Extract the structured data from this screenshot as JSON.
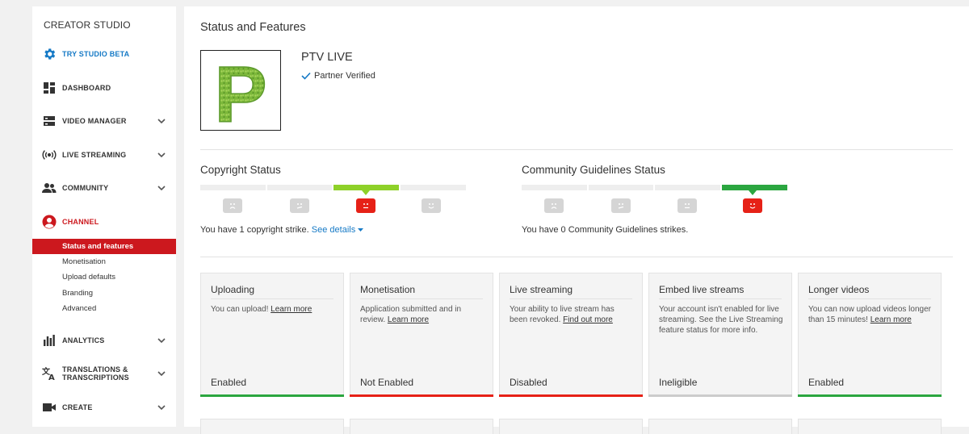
{
  "sidebar": {
    "title": "CREATOR STUDIO",
    "items": [
      {
        "label": "TRY STUDIO BETA",
        "icon": "gear-icon"
      },
      {
        "label": "DASHBOARD",
        "icon": "dashboard-icon"
      },
      {
        "label": "VIDEO MANAGER",
        "icon": "video-manager-icon"
      },
      {
        "label": "LIVE STREAMING",
        "icon": "live-streaming-icon"
      },
      {
        "label": "COMMUNITY",
        "icon": "community-icon"
      },
      {
        "label": "CHANNEL",
        "icon": "channel-icon"
      },
      {
        "label": "ANALYTICS",
        "icon": "analytics-icon"
      },
      {
        "label": "TRANSLATIONS &",
        "label2": "TRANSCRIPTIONS",
        "icon": "translate-icon"
      },
      {
        "label": "CREATE",
        "icon": "camera-icon"
      }
    ],
    "channel_subitems": [
      "Status and features",
      "Monetisation",
      "Upload defaults",
      "Branding",
      "Advanced"
    ],
    "accent_blue": "#167ac6",
    "accent_red": "#cc181e"
  },
  "main": {
    "page_title": "Status and Features",
    "channel_name": "PTV LIVE",
    "partner_status": "Partner Verified",
    "logo_letter": "P",
    "copyright": {
      "title": "Copyright Status",
      "text": "You have 1 copyright strike.",
      "link": "See details",
      "active_level": 3
    },
    "community": {
      "title": "Community Guidelines Status",
      "text": "You have 0 Community Guidelines strikes.",
      "active_level": 4
    },
    "cards": [
      {
        "title": "Uploading",
        "desc": "You can upload!",
        "link": "Learn more",
        "status": "Enabled",
        "color": "#2ba640"
      },
      {
        "title": "Monetisation",
        "desc": "Application submitted and in review.",
        "link": "Learn more",
        "status": "Not Enabled",
        "color": "#e62117"
      },
      {
        "title": "Live streaming",
        "desc": "Your ability to live stream has been revoked.",
        "link": "Find out more",
        "status": "Disabled",
        "color": "#e62117"
      },
      {
        "title": "Embed live streams",
        "desc": "Your account isn't enabled for live streaming. See the Live Streaming feature status for more info.",
        "link": "",
        "status": "Ineligible",
        "color": "#cccccc"
      },
      {
        "title": "Longer videos",
        "desc": "You can now upload videos longer than 15 minutes!",
        "link": "Learn more",
        "status": "Enabled",
        "color": "#2ba640"
      }
    ]
  }
}
